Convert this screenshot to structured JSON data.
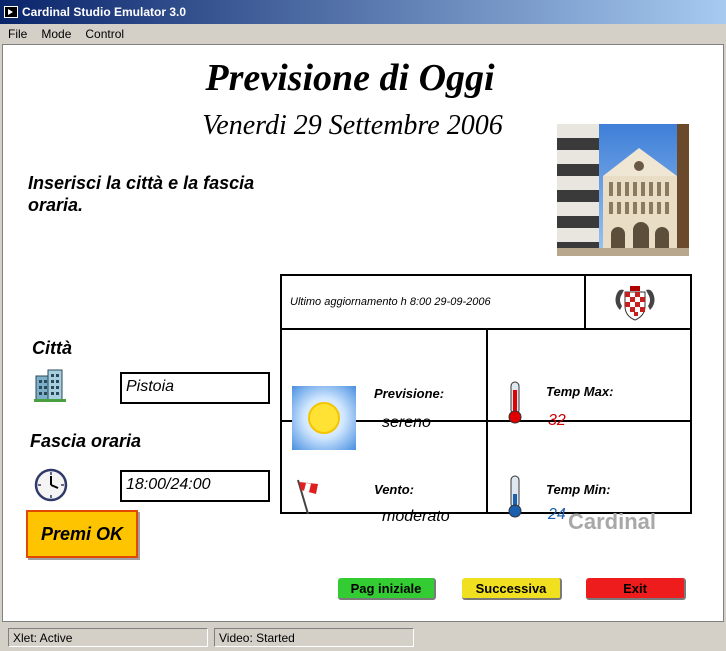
{
  "window": {
    "title": "Cardinal Studio Emulator 3.0"
  },
  "menu": {
    "file": "File",
    "mode": "Mode",
    "control": "Control"
  },
  "page": {
    "title": "Previsione di Oggi",
    "date": "Venerdi 29 Settembre 2006",
    "instruction": "Inserisci la città e la fascia oraria."
  },
  "form": {
    "city_label": "Città",
    "city_value": "Pistoia",
    "time_label": "Fascia oraria",
    "time_value": "18:00/24:00",
    "ok_button": "Premi OK"
  },
  "forecast": {
    "update": "Ultimo aggiornamento h 8:00 29-09-2006",
    "forecast_label": "Previsione:",
    "forecast_value": "sereno",
    "max_label": "Temp Max:",
    "max_value": "32",
    "wind_label": "Vento:",
    "wind_value": "moderato",
    "min_label": "Temp Min:",
    "min_value": "24"
  },
  "nav": {
    "home": "Pag iniziale",
    "next": "Successiva",
    "exit": "Exit",
    "brand": "Cardinal"
  },
  "status": {
    "xlet": "Xlet: Active",
    "video": "Video: Started"
  },
  "colors": {
    "max_temp": "#cc0000",
    "min_temp": "#1a5fb0",
    "home_button": "#33cc33",
    "next_button": "#f0e020",
    "exit_button": "#ee1c1c",
    "ok_button": "#ffc400"
  }
}
